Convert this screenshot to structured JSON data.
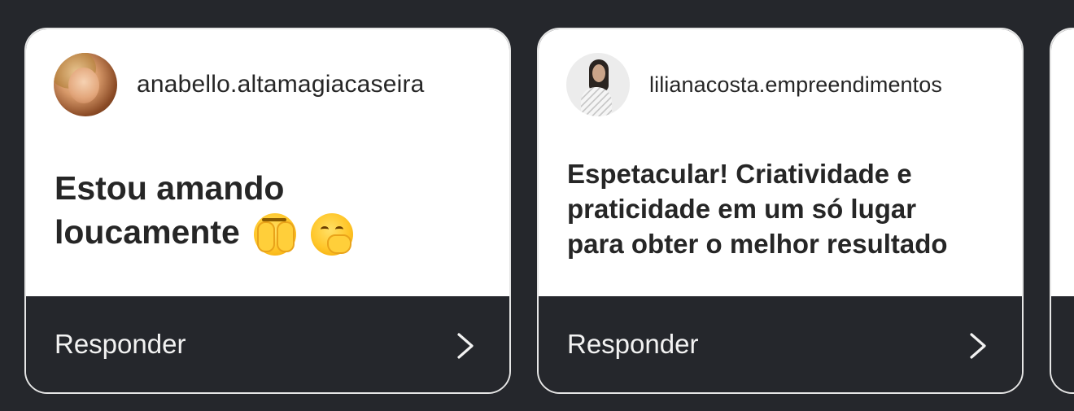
{
  "cards": [
    {
      "username": "anabello.altamagiacaseira",
      "message": "Estou amando loucamente",
      "message_line1": "Estou amando",
      "message_line2": "loucamente",
      "emojis": [
        "face-with-open-eyes-and-hand-over-mouth-emoji",
        "face-with-hand-over-mouth-emoji"
      ],
      "reply_label": "Responder"
    },
    {
      "username": "lilianacosta.empreendimentos",
      "message": "Espetacular! Criatividade e praticidade em um só lugar para obter o melhor resultado",
      "message_line1": "Espetacular! Criatividade e",
      "message_line2": "praticidade em um só lugar",
      "message_line3": "para obter o melhor resultado",
      "reply_label": "Responder"
    }
  ],
  "icons": {
    "reply_chevron": "chevron-right-icon"
  },
  "colors": {
    "background": "#25272c",
    "card_surface": "#ffffff",
    "card_border": "#e6e6e6",
    "text_primary": "#262626",
    "reply_text": "#f2f2f2"
  }
}
